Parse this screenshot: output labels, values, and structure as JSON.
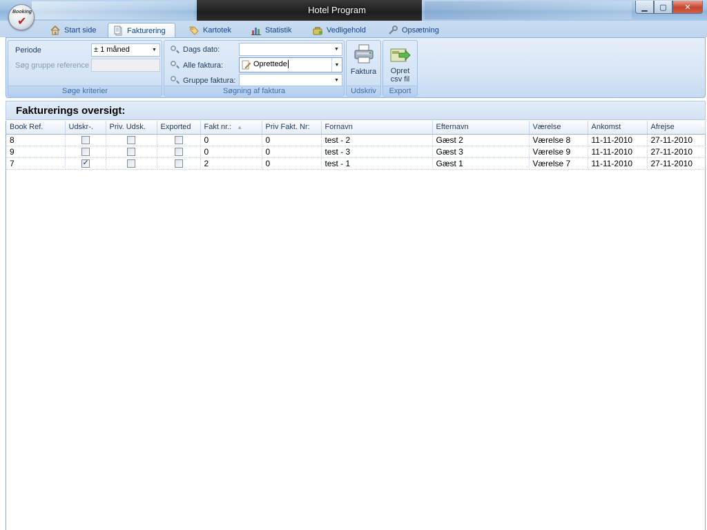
{
  "window": {
    "title": "Hotel Program",
    "minimize": "▁",
    "maximize": "▢",
    "close": "✕",
    "logo_text": "Booking"
  },
  "ribbon": {
    "tabs": [
      {
        "label": "Start side",
        "icon": "home-icon"
      },
      {
        "label": "Fakturering",
        "icon": "document-icon",
        "active": true
      },
      {
        "label": "Kartotek",
        "icon": "tag-icon"
      },
      {
        "label": "Statistik",
        "icon": "chart-icon"
      },
      {
        "label": "Vedligehold",
        "icon": "bag-icon"
      },
      {
        "label": "Opsætning",
        "icon": "wrench-icon"
      }
    ],
    "search_group": {
      "label": "Søge kriterier",
      "periode_label": "Periode",
      "periode_value": "± 1 måned",
      "group_ref_label": "Søg gruppe reference",
      "group_ref_value": ""
    },
    "invoice_search_group": {
      "label": "Søgning af faktura",
      "dags_dato_label": "Dags dato:",
      "dags_dato_value": "",
      "alle_faktura_label": "Alle faktura:",
      "alle_faktura_value": "Oprettede",
      "gruppe_faktura_label": "Gruppe faktura:",
      "gruppe_faktura_value": ""
    },
    "print_group": {
      "label": "Udskriv",
      "button": "Faktura"
    },
    "export_group": {
      "label": "Export",
      "button_line1": "Opret",
      "button_line2": "csv fil"
    }
  },
  "overview_title": "Fakturerings oversigt:",
  "grid": {
    "columns": [
      "Book Ref.",
      "Udskr-.",
      "Priv. Udsk.",
      "Exported",
      "Fakt nr.:",
      "Priv Fakt. Nr:",
      "Fornavn",
      "Efternavn",
      "Værelse",
      "Ankomst",
      "Afrejse"
    ],
    "rows": [
      {
        "book_ref": "8",
        "udskr": false,
        "priv_udsk": false,
        "exported": false,
        "fakt_nr": "0",
        "priv_fakt_nr": "0",
        "fornavn": "test - 2",
        "efternavn": "Gæst 2",
        "vaerelse": "Værelse 8",
        "ankomst": "11-11-2010",
        "afrejse": "27-11-2010"
      },
      {
        "book_ref": "9",
        "udskr": false,
        "priv_udsk": false,
        "exported": false,
        "fakt_nr": "0",
        "priv_fakt_nr": "0",
        "fornavn": "test - 3",
        "efternavn": "Gæst 3",
        "vaerelse": "Værelse 9",
        "ankomst": "11-11-2010",
        "afrejse": "27-11-2010"
      },
      {
        "book_ref": "7",
        "udskr": true,
        "priv_udsk": false,
        "exported": false,
        "fakt_nr": "2",
        "priv_fakt_nr": "0",
        "fornavn": "test - 1",
        "efternavn": "Gæst 1",
        "vaerelse": "Værelse 7",
        "ankomst": "11-11-2010",
        "afrejse": "27-11-2010"
      }
    ]
  }
}
